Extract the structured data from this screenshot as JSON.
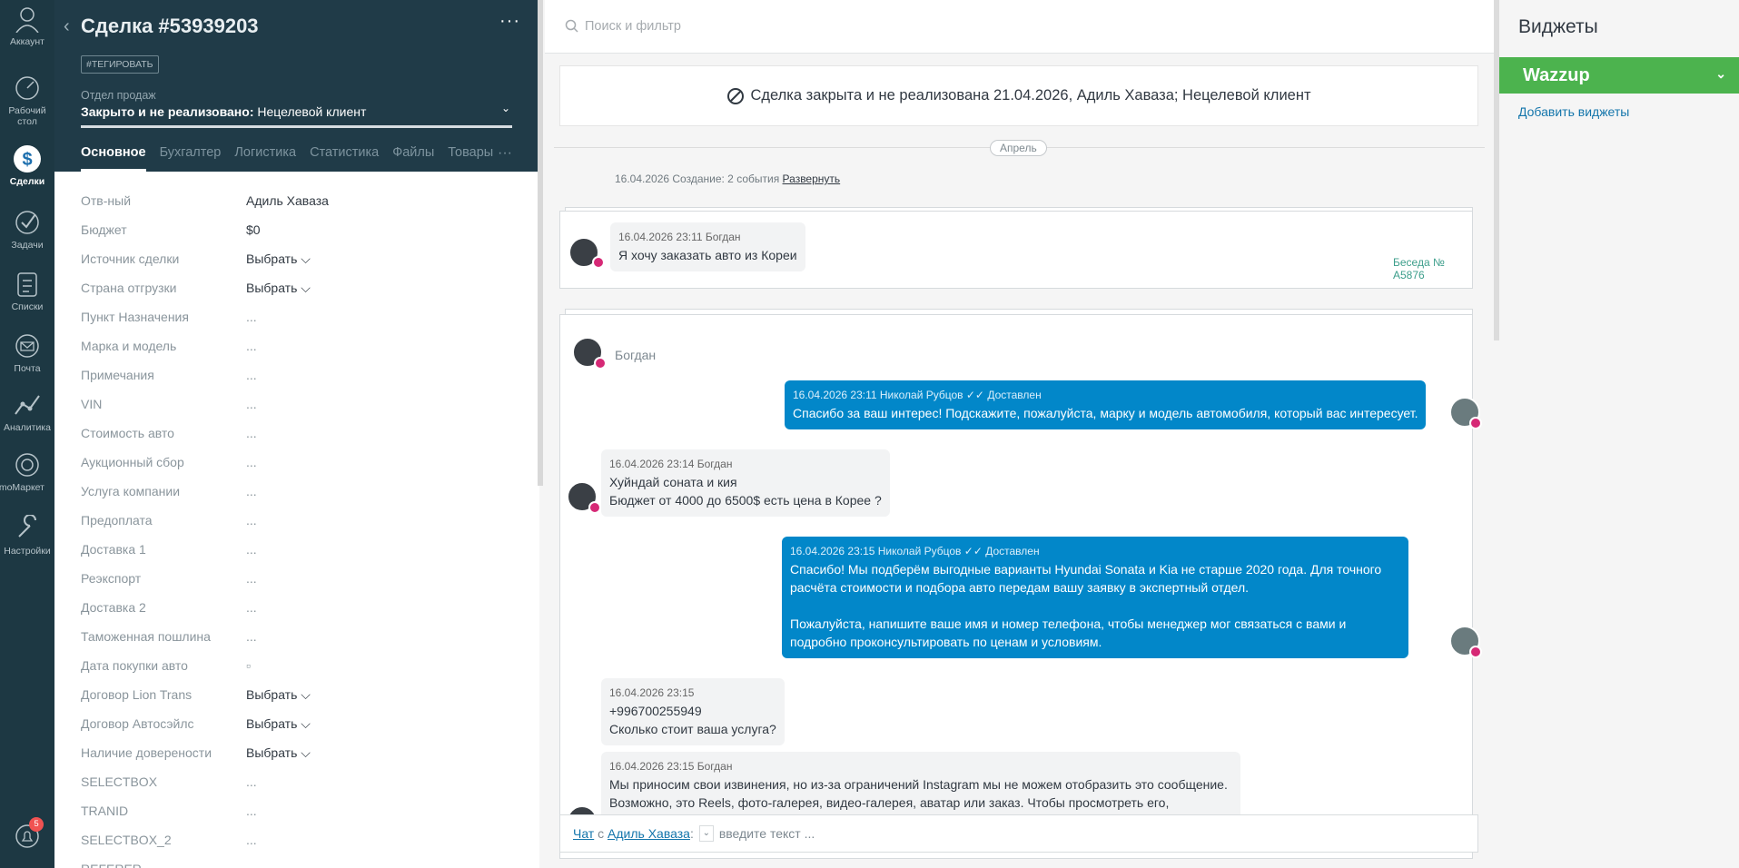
{
  "nav": [
    {
      "label": "Аккаунт",
      "icon": "user-icon"
    },
    {
      "label": "Рабочий стол",
      "icon": "dashboard-icon"
    },
    {
      "label": "Сделки",
      "icon": "dollar-icon"
    },
    {
      "label": "Задачи",
      "icon": "check-icon"
    },
    {
      "label": "Списки",
      "icon": "list-icon"
    },
    {
      "label": "Почта",
      "icon": "mail-icon"
    },
    {
      "label": "Аналитика",
      "icon": "chart-icon"
    },
    {
      "label": "amoМаркет",
      "icon": "market-icon"
    },
    {
      "label": "Настройки",
      "icon": "settings-icon"
    }
  ],
  "notif_count": "5",
  "deal": {
    "title": "Сделка #53939203",
    "tag_button": "#ТЕГИРОВАТЬ",
    "pipeline_label": "Отдел продаж",
    "status_prefix": "Закрыто и не реализовано:",
    "status_reason": "Нецелевой клиент",
    "tabs": [
      "Основное",
      "Бухгалтер",
      "Логистика",
      "Статистика",
      "Файлы",
      "Товары"
    ],
    "fields": [
      {
        "label": "Отв-ный",
        "value": "Адиль Хаваза"
      },
      {
        "label": "Бюджет",
        "value": "$0"
      },
      {
        "label": "Источник сделки",
        "value": "Выбрать ⌵"
      },
      {
        "label": "Страна отгрузки",
        "value": "Выбрать ⌵"
      },
      {
        "label": "Пункт Назначения",
        "value": "..."
      },
      {
        "label": "Марка и модель",
        "value": "..."
      },
      {
        "label": "Примечания",
        "value": "..."
      },
      {
        "label": "VIN",
        "value": "..."
      },
      {
        "label": "Стоимость авто",
        "value": "..."
      },
      {
        "label": "Аукционный сбор",
        "value": "..."
      },
      {
        "label": "Услуга компании",
        "value": "..."
      },
      {
        "label": "Предоплата",
        "value": "..."
      },
      {
        "label": "Доставка 1",
        "value": "..."
      },
      {
        "label": "Реэкспорт",
        "value": "..."
      },
      {
        "label": "Доставка 2",
        "value": "..."
      },
      {
        "label": "Таможенная пошлина",
        "value": "..."
      },
      {
        "label": "Дата покупки авто",
        "value": "▫"
      },
      {
        "label": "Договор Lion Trans",
        "value": "Выбрать ⌵"
      },
      {
        "label": "Договор Автосэйлс",
        "value": "Выбрать ⌵"
      },
      {
        "label": "Наличие доверености",
        "value": "Выбрать ⌵"
      },
      {
        "label": "SELECTBOX",
        "value": "..."
      },
      {
        "label": "TRANID",
        "value": "..."
      },
      {
        "label": "SELECTBOX_2",
        "value": "..."
      },
      {
        "label": "REFERER",
        "value": ""
      }
    ]
  },
  "feed": {
    "search_placeholder": "Поиск и фильтр",
    "closed_banner": "Сделка закрыта и не реализована 21.04.2026, Адиль Хаваза; Нецелевой клиент",
    "month": "Апрель",
    "events_line": "16.04.2026 Создание: 2 события",
    "events_link": "Развернуть",
    "conv_ref": "Беседа № A5876",
    "first_msg": {
      "meta": "16.04.2026 23:11 Богдан",
      "text": "Я хочу заказать авто из Кореи"
    },
    "chat_contact": "Богдан",
    "messages": [
      {
        "meta": "16.04.2026 23:11 Николай Рубцов ✓✓ Доставлен",
        "lines": [
          "Спасибо за ваш интерес! Подскажите, пожалуйста, марку и модель автомобиля, который вас интересует."
        ]
      },
      {
        "meta": "16.04.2026 23:14 Богдан",
        "lines": [
          "Хуйндай соната и кия",
          "Бюджет от 4000 до 6500$ есть цена в Корее ?"
        ]
      },
      {
        "meta": "16.04.2026 23:15 Николай Рубцов ✓✓ Доставлен",
        "lines": [
          "Спасибо! Мы подберём выгодные варианты Hyundai Sonata и Kia не старше 2020 года. Для точного расчёта стоимости и подбора авто передам вашу заявку в экспертный отдел.",
          "",
          "Пожалуйста, напишите ваше имя и номер телефона, чтобы менеджер мог связаться с вами и подробно проконсультировать по ценам и условиям."
        ]
      },
      {
        "meta": "16.04.2026 23:15",
        "lines": [
          "+996700255949",
          "Сколько стоит ваша услуга?"
        ]
      },
      {
        "meta": "16.04.2026 23:15 Богдан",
        "lines": [
          "Мы приносим свои извинения, но из-за ограничений Instagram мы не можем отобразить это сообщение. Возможно, это Reels, фото-галерея, видео-галерея, аватар или заказ. Чтобы просмотреть его,"
        ]
      }
    ],
    "chatbar": {
      "chat": "Чат",
      "with": "с",
      "contact": "Адиль Хаваза",
      "placeholder": "введите текст ..."
    }
  },
  "widgets": {
    "title": "Виджеты",
    "wazzup": "Wazzup",
    "add": "Добавить виджеты",
    "wazzup_color": "#4cb34e"
  }
}
